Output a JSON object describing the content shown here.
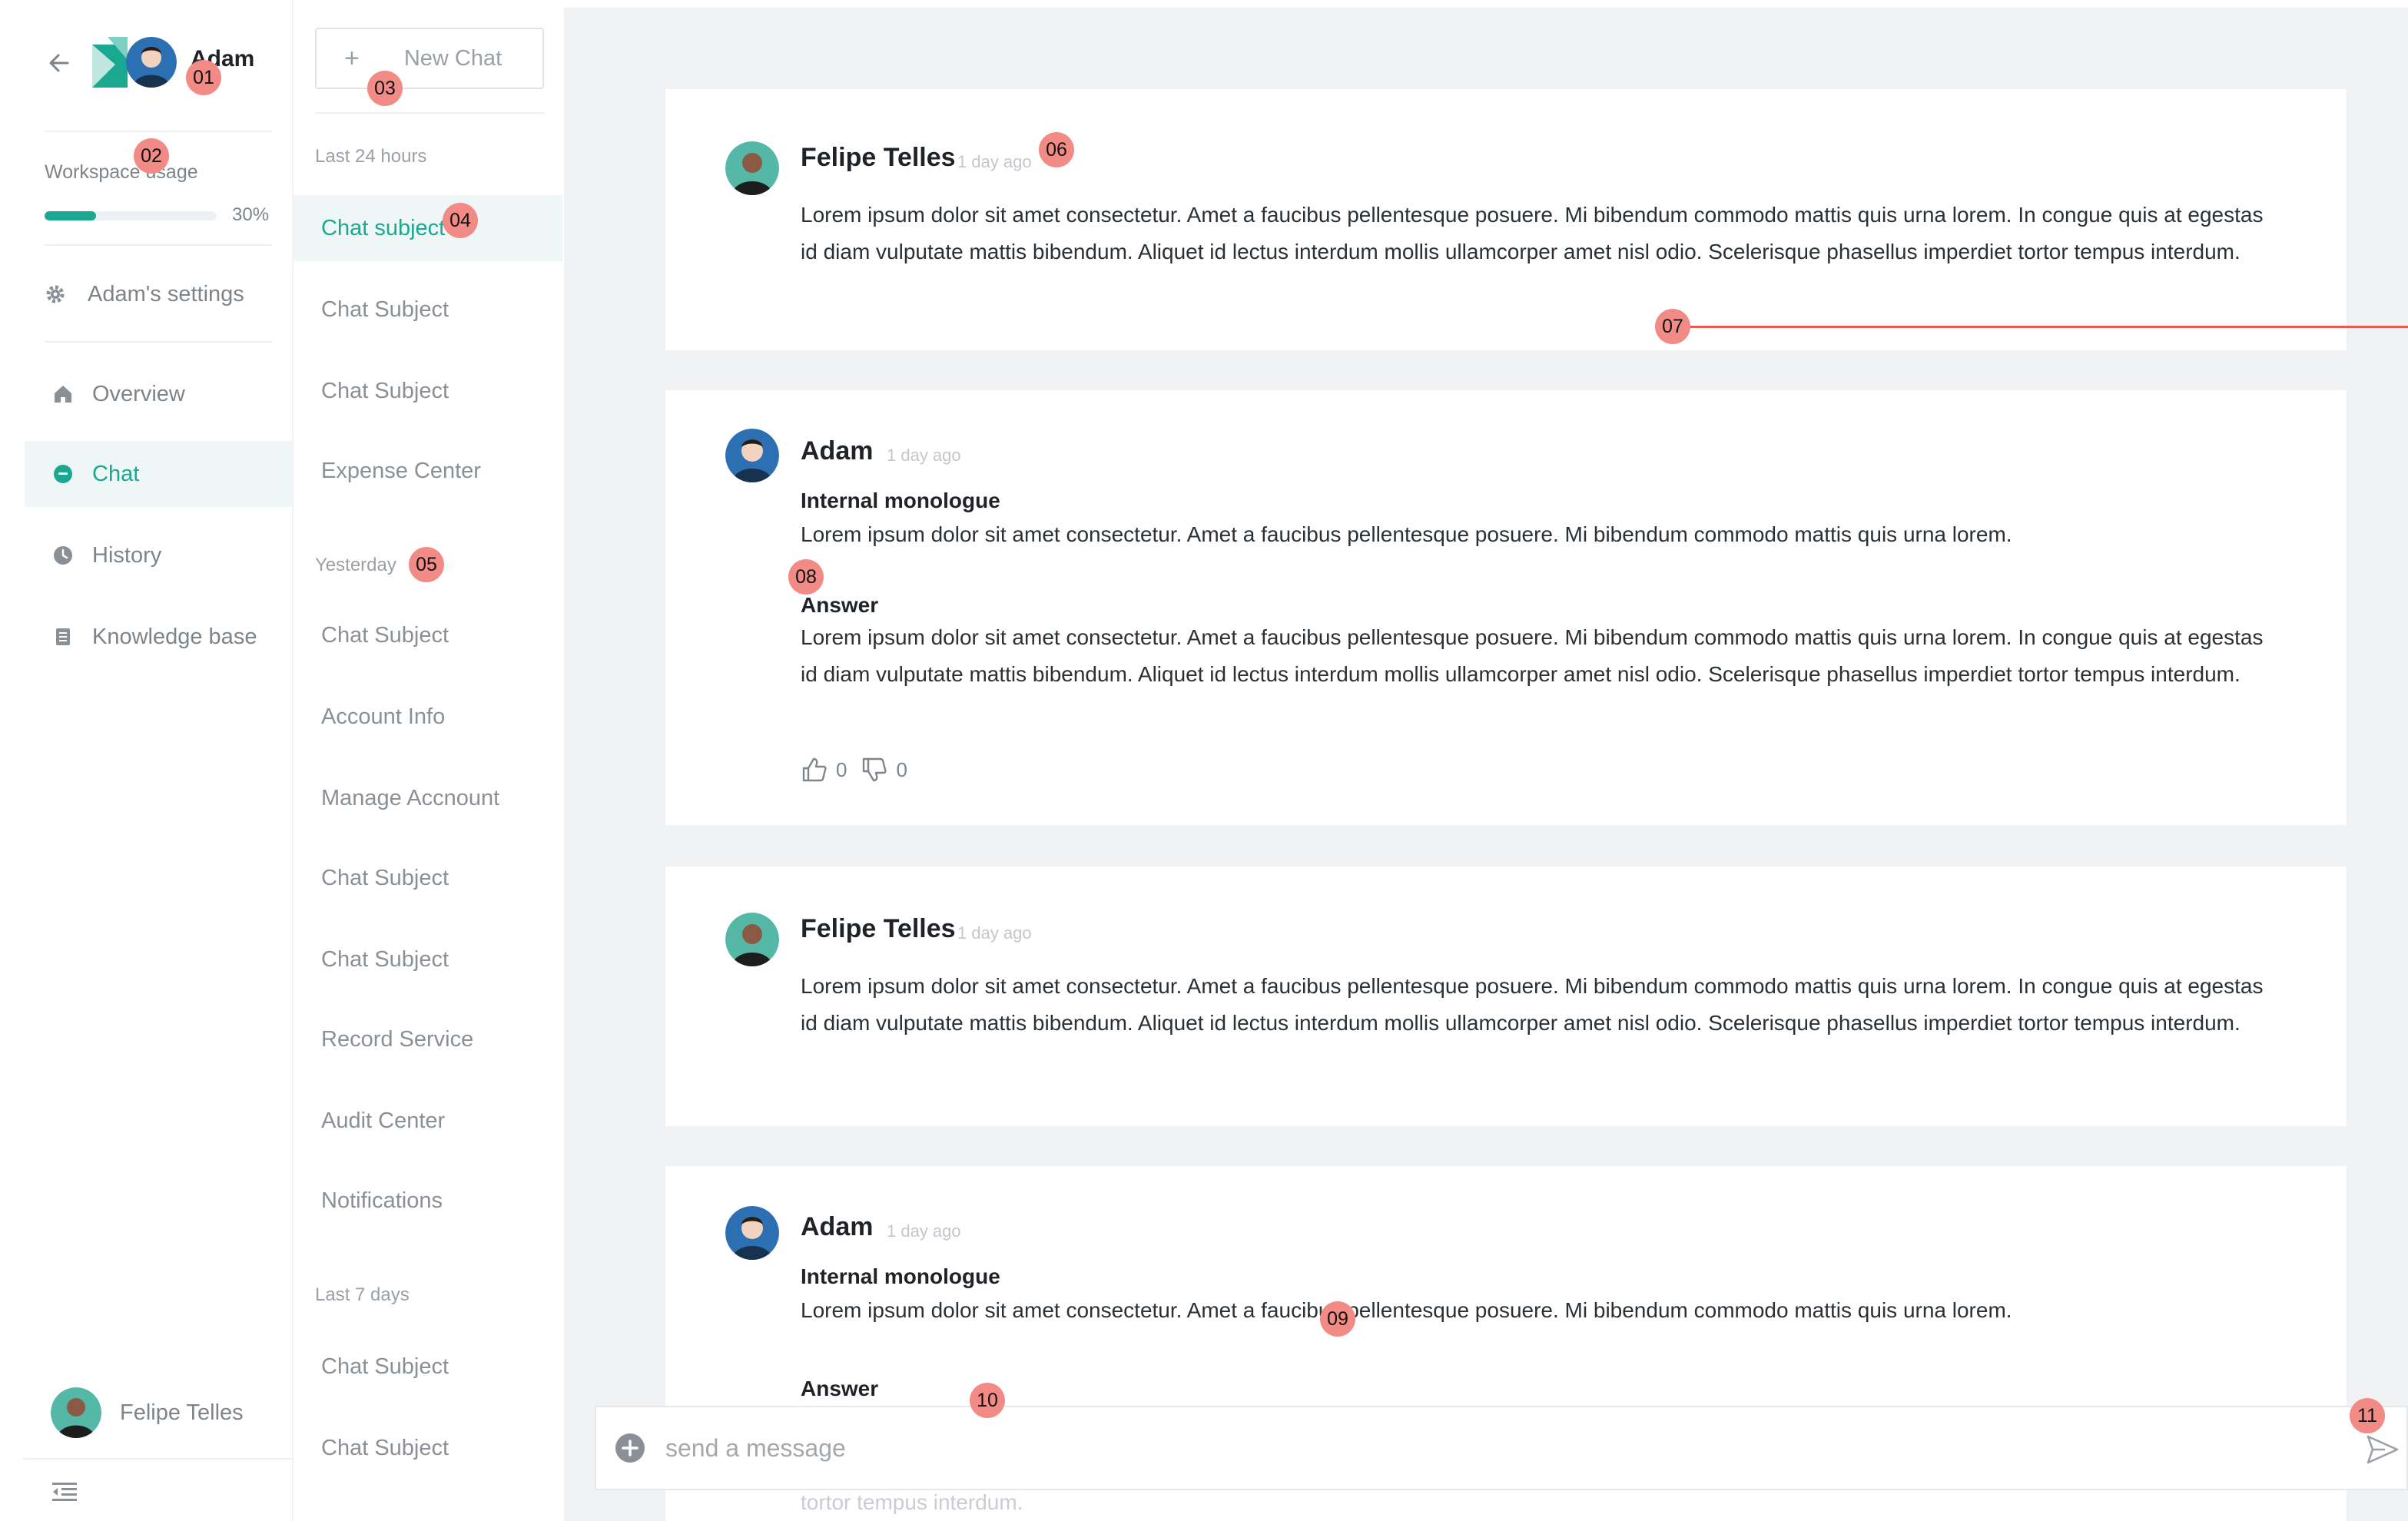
{
  "user": {
    "name": "Adam"
  },
  "workspace": {
    "usage_label": "Workspace usage",
    "usage_percent_text": "30%",
    "usage_fraction": 0.3
  },
  "nav": {
    "settings_label": "Adam's settings",
    "items": [
      {
        "label": "Overview",
        "icon": "home-icon",
        "active": false
      },
      {
        "label": "Chat",
        "icon": "chat-bubble-icon",
        "active": true
      },
      {
        "label": "History",
        "icon": "clock-icon",
        "active": false
      },
      {
        "label": "Knowledge base",
        "icon": "book-icon",
        "active": false
      }
    ]
  },
  "profile": {
    "name": "Felipe Telles"
  },
  "chat_list": {
    "new_chat_label": "New Chat",
    "groups": [
      {
        "label": "Last 24 hours",
        "items": [
          "Chat subject",
          "Chat Subject",
          "Chat Subject",
          "Expense Center"
        ]
      },
      {
        "label": "Yesterday",
        "items": [
          "Chat Subject",
          "Account Info",
          "Manage Accnount",
          "Chat Subject",
          "Chat Subject",
          "Record Service",
          "Audit Center",
          "Notifications"
        ]
      },
      {
        "label": "Last 7 days",
        "items": [
          "Chat Subject",
          "Chat Subject"
        ]
      }
    ]
  },
  "messages": [
    {
      "author": "Felipe Telles",
      "time": "1 day ago",
      "text": "Lorem ipsum dolor sit amet consectetur. Amet a faucibus pellentesque posuere. Mi bibendum commodo mattis quis urna lorem. In congue quis at egestas id diam vulputate mattis bibendum. Aliquet id lectus interdum mollis ullamcorper amet nisl odio. Scelerisque phasellus imperdiet tortor tempus interdum."
    },
    {
      "author": "Adam",
      "time": "1 day ago",
      "monologue_heading": "Internal monologue",
      "monologue_text": "Lorem ipsum dolor sit amet consectetur. Amet a faucibus pellentesque posuere. Mi bibendum commodo mattis quis urna lorem.",
      "answer_heading": "Answer",
      "answer_text": "Lorem ipsum dolor sit amet consectetur. Amet a faucibus pellentesque posuere. Mi bibendum commodo mattis quis urna lorem. In congue quis at egestas id diam vulputate mattis bibendum. Aliquet id lectus interdum mollis ullamcorper amet nisl odio. Scelerisque phasellus imperdiet tortor tempus interdum.",
      "likes": "0",
      "dislikes": "0"
    },
    {
      "author": "Felipe Telles",
      "time": "1 day ago",
      "text": "Lorem ipsum dolor sit amet consectetur. Amet a faucibus pellentesque posuere. Mi bibendum commodo mattis quis urna lorem. In congue quis at egestas id diam vulputate mattis bibendum. Aliquet id lectus interdum mollis ullamcorper amet nisl odio. Scelerisque phasellus imperdiet tortor tempus interdum."
    },
    {
      "author": "Adam",
      "time": "1 day ago",
      "monologue_heading": "Internal monologue",
      "monologue_text": "Lorem ipsum dolor sit amet consectetur. Amet a faucibus pellentesque posuere. Mi bibendum commodo mattis quis urna lorem.",
      "answer_heading": "Answer",
      "answer_tail": "tortor tempus interdum."
    }
  ],
  "composer": {
    "placeholder": "send a message"
  },
  "markers": [
    "01",
    "02",
    "03",
    "04",
    "05",
    "06",
    "07",
    "08",
    "09",
    "10",
    "11"
  ],
  "colors": {
    "accent": "#1aa891",
    "accent_bg": "#eef7f5",
    "marker": "#f28b86",
    "marker_line": "#e55a55"
  }
}
